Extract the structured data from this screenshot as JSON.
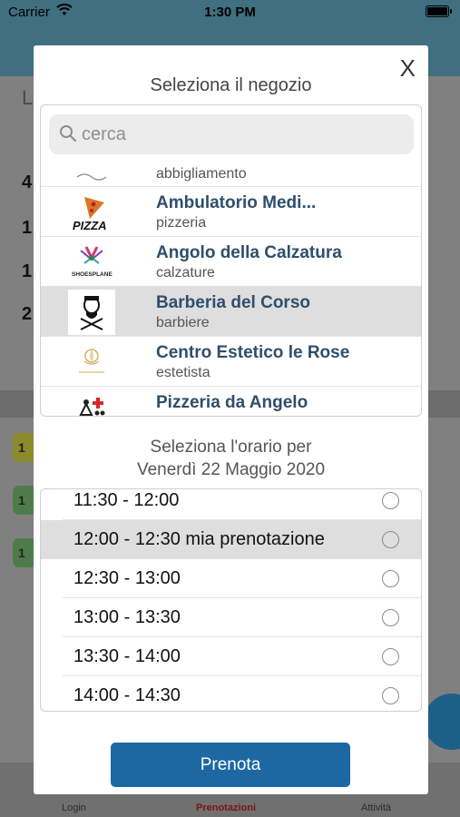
{
  "status_bar": {
    "carrier": "Carrier",
    "time": "1:30 PM"
  },
  "background": {
    "rows": [
      "4",
      "1",
      "1",
      "2"
    ],
    "chips": [
      "1",
      "1",
      "1"
    ],
    "letter": "L"
  },
  "tab_bar": {
    "tabs": [
      {
        "label": "Login"
      },
      {
        "label": "Prenotazioni"
      },
      {
        "label": "Attività"
      }
    ]
  },
  "modal": {
    "close_label": "X",
    "title": "Seleziona il negozio",
    "search": {
      "placeholder": "cerca",
      "value": ""
    },
    "shops": [
      {
        "name": "",
        "category": "abbigliamento",
        "logo": "clothing-logo-icon",
        "selected": false
      },
      {
        "name": "Ambulatorio Medi...",
        "category": "pizzeria",
        "logo": "pizza-logo-icon",
        "logo_text": "PIZZA",
        "selected": false
      },
      {
        "name": "Angolo della Calzatura",
        "category": "calzature",
        "logo": "shoes-logo-icon",
        "logo_text": "SHOESPLANE",
        "selected": false
      },
      {
        "name": "Barberia del Corso",
        "category": "barbiere",
        "logo": "barber-logo-icon",
        "selected": true
      },
      {
        "name": "Centro Estetico le Rose",
        "category": "estetista",
        "logo": "beauty-logo-icon",
        "selected": false
      },
      {
        "name": "Pizzeria da Angelo",
        "category": "",
        "logo": "medical-logo-icon",
        "selected": false
      }
    ],
    "slot_caption_line1": "Seleziona l'orario per",
    "slot_caption_line2": "Venerdì 22 Maggio 2020",
    "slots": [
      {
        "label": "11:30 - 12:00",
        "selected": false
      },
      {
        "label": "12:00 - 12:30 mia prenotazione",
        "selected": true
      },
      {
        "label": "12:30 - 13:00",
        "selected": false
      },
      {
        "label": "13:00 - 13:30",
        "selected": false
      },
      {
        "label": "13:30 - 14:00",
        "selected": false
      },
      {
        "label": "14:00 - 14:30",
        "selected": false
      }
    ],
    "submit_label": "Prenota"
  },
  "colors": {
    "nav_teal": "#3f6f80",
    "shop_name": "#2e4f6b",
    "button_blue": "#1d68a2",
    "selected_row": "#dedede",
    "active_tab": "#7a1616"
  }
}
